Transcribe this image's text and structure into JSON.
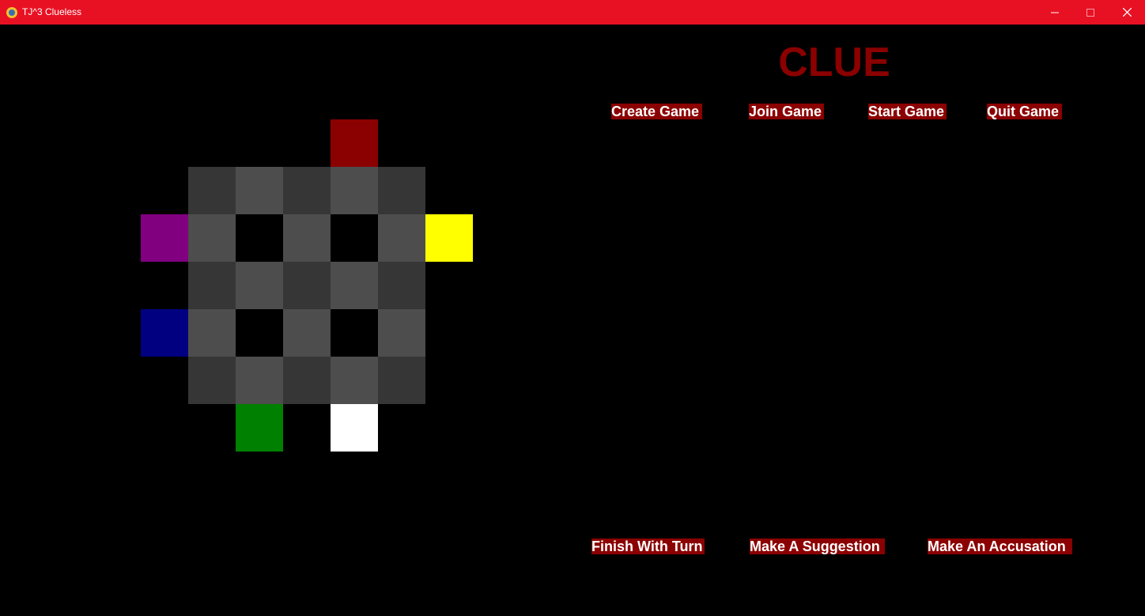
{
  "window": {
    "title": "TJ^3 Clueless"
  },
  "game": {
    "title": "CLUE",
    "buttons": {
      "create": "Create Game",
      "join": "Join Game",
      "start": "Start Game",
      "quit": "Quit Game",
      "finish": "Finish With Turn",
      "suggest": "Make A Suggestion",
      "accuse": "Make An Accusation"
    }
  },
  "colors": {
    "titlebar": "#e81123",
    "title_text": "#8b0000",
    "button_bg": "#8b0000",
    "button_text": "#ffffff",
    "dark_tile": "#363636",
    "light_tile": "#4d4d4d",
    "token_red": "#8b0000",
    "token_purple": "#800080",
    "token_yellow": "#ffff00",
    "token_blue": "#000080",
    "token_green": "#008000",
    "token_white": "#ffffff"
  }
}
